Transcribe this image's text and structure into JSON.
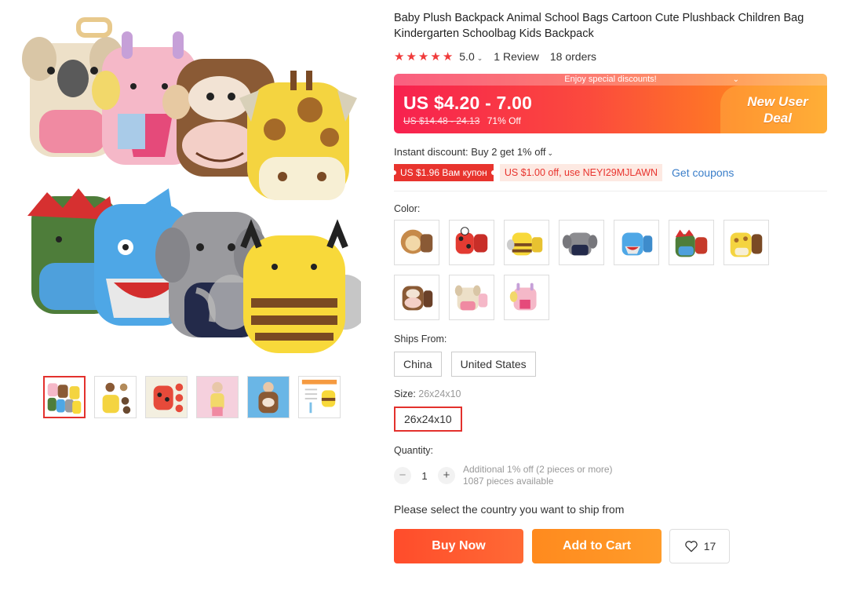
{
  "product": {
    "title": "Baby Plush Backpack Animal School Bags Cartoon Cute Plushback Children Bag Kindergarten Schoolbag Kids Backpack",
    "rating": "5.0",
    "reviews": "1 Review",
    "orders": "18 orders",
    "star_count": 5
  },
  "price": {
    "banner_strip": "Enjoy special discounts!",
    "current": "US $4.20 - 7.00",
    "original": "US $14.48 - 24.13",
    "discount": "71% Off",
    "deal_line1": "New User",
    "deal_line2": "Deal"
  },
  "discounts": {
    "instant": "Instant discount: Buy 2 get 1% off",
    "coupon_red": "US $1.96 Вам купон",
    "coupon_code": "US $1.00 off, use NEYI29MJLAWN",
    "get_coupons": "Get coupons"
  },
  "color": {
    "label": "Color:",
    "options": [
      "lion",
      "ladybug",
      "bee",
      "elephant",
      "shark",
      "dinosaur",
      "giraffe",
      "monkey",
      "koala",
      "unicorn"
    ]
  },
  "ships_from": {
    "label": "Ships From:",
    "options": [
      "China",
      "United States"
    ]
  },
  "size": {
    "label": "Size:",
    "selected_value": "26x24x10",
    "options": [
      "26x24x10"
    ]
  },
  "quantity": {
    "label": "Quantity:",
    "value": "1",
    "minus": "−",
    "plus": "+",
    "note_line1": "Additional 1% off (2 pieces or more)",
    "note_line2": "1087 pieces available"
  },
  "shipping_message": "Please select the country you want to ship from",
  "actions": {
    "buy_now": "Buy Now",
    "add_to_cart": "Add to Cart",
    "wishlist_count": "17"
  },
  "colors": {
    "accent_red": "#e3312d",
    "buy_now": "#ff5330",
    "add_to_cart": "#ff931f",
    "link_blue": "#3a7ec9",
    "star": "#f03a3a"
  }
}
